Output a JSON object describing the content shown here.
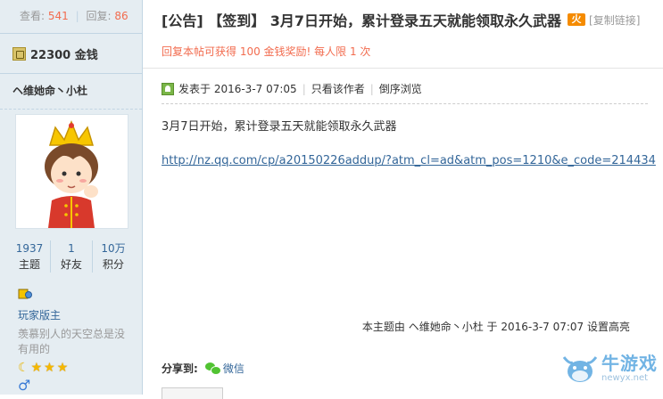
{
  "sidebar": {
    "stats": {
      "views_label": "查看:",
      "views_count": "541",
      "separator": "|",
      "replies_label": "回复:",
      "replies_count": "86"
    },
    "coins": "22300 金钱",
    "author_name": "ヘ维她命丶小杜",
    "user_stats": [
      {
        "value": "1937",
        "label": "主题"
      },
      {
        "value": "1",
        "label": "好友"
      },
      {
        "value": "10万",
        "label": "积分"
      }
    ],
    "rank_name": "玩家版主",
    "signature": "羡慕别人的天空总是没有用的",
    "gender_symbol": "♂",
    "moon_symbol": "☾",
    "star_symbol": "★",
    "star_count": 3
  },
  "post": {
    "title": "[公告] 【签到】 3月7日开始，累计登录五天就能领取永久武器",
    "hot_icon_text": "火",
    "copy_link": "[复制链接]",
    "reward_notice": "回复本帖可获得 100 金钱奖励! 每人限 1 次",
    "posted_at": "发表于 2016-3-7 07:05",
    "meta_sep": "|",
    "only_author": "只看该作者",
    "reverse_order": "倒序浏览",
    "body_line": "3月7日开始，累计登录五天就能领取永久武器",
    "body_link": "http://nz.qq.com/cp/a20150226addup/?atm_cl=ad&atm_pos=1210&e_code=214434",
    "edit_note": "本主题由 ヘ维她命丶小杜 于 2016-3-7 07:07 设置高亮",
    "share_label": "分享到:",
    "wechat_label": "微信"
  },
  "watermark": {
    "brand": "牛游戏",
    "url": "newyx.net"
  },
  "colors": {
    "sidebar_bg": "#e5edf2",
    "border": "#c2d5e3",
    "accent_red": "#f26c4f",
    "link_blue": "#336699"
  }
}
